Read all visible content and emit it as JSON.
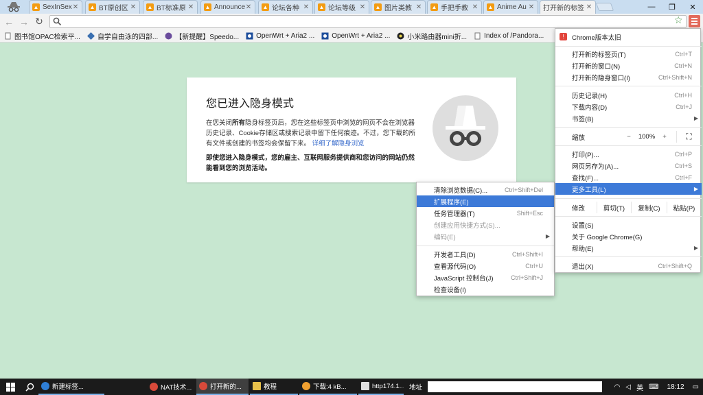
{
  "tabs": [
    {
      "label": "SexInSex!",
      "favicon": "forum-favicon"
    },
    {
      "label": "BT原创区",
      "favicon": "forum-favicon"
    },
    {
      "label": "BT标准原",
      "favicon": "forum-favicon"
    },
    {
      "label": "Announce",
      "favicon": "forum-favicon"
    },
    {
      "label": "论坛各种",
      "favicon": "forum-favicon"
    },
    {
      "label": "论坛等级",
      "favicon": "forum-favicon"
    },
    {
      "label": "图片类教",
      "favicon": "forum-favicon"
    },
    {
      "label": "手把手教",
      "favicon": "forum-favicon"
    },
    {
      "label": "Anime Au",
      "favicon": "forum-favicon"
    },
    {
      "label": "打开新的标签",
      "favicon": "none",
      "active": true
    }
  ],
  "window": {
    "minimize": "—",
    "maximize": "❐",
    "close": "✕"
  },
  "toolbar": {
    "back": "←",
    "forward": "→",
    "reload": "↻",
    "omnibox_value": ""
  },
  "bookmarks": [
    {
      "label": "图书馆OPAC检索平...",
      "icon": "page-icon"
    },
    {
      "label": "自学自由泳的四部...",
      "icon": "globe-icon"
    },
    {
      "label": "【新提醒】Speedo...",
      "icon": "app-icon"
    },
    {
      "label": "OpenWrt + Aria2 ...",
      "icon": "photo-icon"
    },
    {
      "label": "OpenWrt + Aria2 ...",
      "icon": "photo-icon"
    },
    {
      "label": "小米路由器mini折...",
      "icon": "router-icon"
    },
    {
      "label": "Index of /Pandora...",
      "icon": "page-icon"
    }
  ],
  "incognito": {
    "title": "您已进入隐身模式",
    "para_pre": "在您关闭",
    "para_bold": "所有",
    "para_post": "隐身标签页后，您在这些标签页中浏览的网页不会在浏览器历史记录、Cookie存储区或搜索记录中留下任何痕迹。不过，您下载的所有文件或创建的书签均会保留下来。",
    "learn_more": "详细了解隐身浏览",
    "warning": "即使您进入隐身模式，您的雇主、互联网服务提供商和您访问的网站仍然能看到您的浏览活动。"
  },
  "main_menu": {
    "update": "Chrome版本太旧",
    "new_tab": {
      "label": "打开新的标签页(T)",
      "shortcut": "Ctrl+T"
    },
    "new_window": {
      "label": "打开新的窗口(N)",
      "shortcut": "Ctrl+N"
    },
    "new_incognito": {
      "label": "打开新的隐身窗口(I)",
      "shortcut": "Ctrl+Shift+N"
    },
    "history": {
      "label": "历史记录(H)",
      "shortcut": "Ctrl+H"
    },
    "downloads": {
      "label": "下载内容(D)",
      "shortcut": "Ctrl+J"
    },
    "bookmarks": {
      "label": "书签(B)"
    },
    "zoom": {
      "label": "缩放",
      "minus": "−",
      "value": "100%",
      "plus": "+",
      "fullscreen": "⛶"
    },
    "print": {
      "label": "打印(P)...",
      "shortcut": "Ctrl+P"
    },
    "save_as": {
      "label": "网页另存为(A)...",
      "shortcut": "Ctrl+S"
    },
    "find": {
      "label": "查找(F)...",
      "shortcut": "Ctrl+F"
    },
    "more_tools": {
      "label": "更多工具(L)"
    },
    "edit": {
      "label": "修改",
      "cut": "剪切(T)",
      "copy": "复制(C)",
      "paste": "粘贴(P)"
    },
    "settings": {
      "label": "设置(S)"
    },
    "about": {
      "label": "关于 Google Chrome(G)"
    },
    "help": {
      "label": "帮助(E)"
    },
    "exit": {
      "label": "退出(X)",
      "shortcut": "Ctrl+Shift+Q"
    }
  },
  "more_tools_menu": {
    "clear_data": {
      "label": "清除浏览数据(C)...",
      "shortcut": "Ctrl+Shift+Del"
    },
    "extensions": {
      "label": "扩展程序(E)"
    },
    "task_manager": {
      "label": "任务管理器(T)",
      "shortcut": "Shift+Esc"
    },
    "create_shortcut": {
      "label": "创建应用快捷方式(S)..."
    },
    "encoding": {
      "label": "编码(E)"
    },
    "devtools": {
      "label": "开发者工具(D)",
      "shortcut": "Ctrl+Shift+I"
    },
    "view_source": {
      "label": "查看源代码(O)",
      "shortcut": "Ctrl+U"
    },
    "js_console": {
      "label": "JavaScript 控制台(J)",
      "shortcut": "Ctrl+Shift+J"
    },
    "inspect_devices": {
      "label": "检查设备(I)"
    }
  },
  "taskbar": {
    "items": [
      {
        "label": "新建标签...",
        "icon": "edge-icon",
        "color": "#2f7fd6"
      },
      {
        "label": "NAT技术...",
        "icon": "chrome-icon",
        "color": "#d94a3a"
      },
      {
        "label": "打开新的...",
        "icon": "chrome-icon",
        "color": "#d94a3a"
      },
      {
        "label": "教程",
        "icon": "folder-icon",
        "color": "#e8c04a"
      },
      {
        "label": "下载:4 kB...",
        "icon": "download-icon",
        "color": "#f0a030"
      },
      {
        "label": "http174.1...",
        "icon": "file-icon",
        "color": "#dddddd"
      }
    ],
    "address_label": "地址",
    "ime": "英",
    "clock": "18:12"
  }
}
